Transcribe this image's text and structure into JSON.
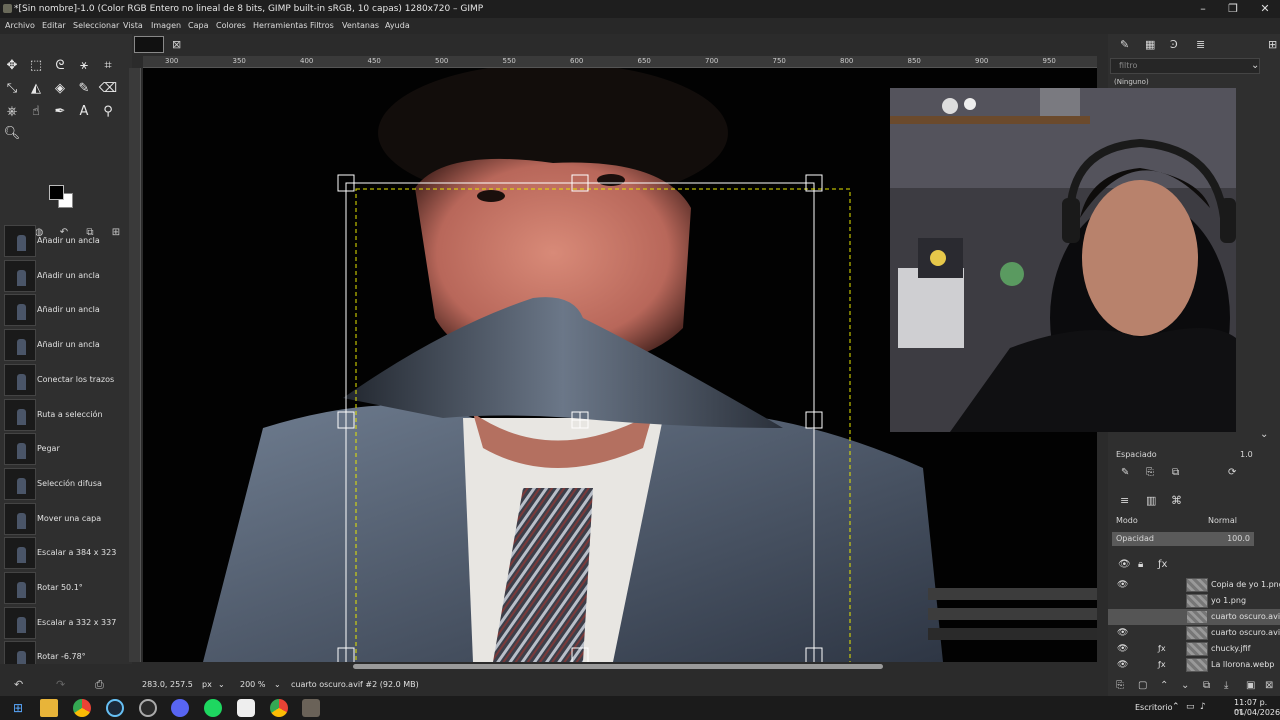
{
  "window": {
    "title": "*[Sin nombre]-1.0 (Color RGB Entero no lineal de 8 bits, GIMP built-in sRGB, 10 capas) 1280x720 – GIMP",
    "minimize": "–",
    "maximize": "❐",
    "close": "✕"
  },
  "menu": [
    "Archivo",
    "Editar",
    "Seleccionar",
    "Vista",
    "Imagen",
    "Capa",
    "Colores",
    "Herramientas",
    "Filtros",
    "Ventanas",
    "Ayuda"
  ],
  "history": [
    "Añadir un ancla",
    "Añadir un ancla",
    "Añadir un ancla",
    "Añadir un ancla",
    "Conectar los trazos",
    "Ruta a selección",
    "Pegar",
    "Selección difusa",
    "Mover una capa",
    "Escalar a 384 x 323",
    "Rotar 50.1°",
    "Escalar a 332 x 337",
    "Rotar -6.78°"
  ],
  "ruler": {
    "ticks": [
      "300",
      "350",
      "400",
      "450",
      "500",
      "550",
      "600",
      "650",
      "700",
      "750",
      "800",
      "850",
      "900",
      "950"
    ]
  },
  "status": {
    "coords": "283.0, 257.5",
    "unit": "px",
    "zoom": "200 %",
    "layer_info": "cuarto oscuro.avif #2 (92.0 MB)"
  },
  "dock": {
    "filter_placeholder": "filtro",
    "brush_none": "(Ninguno)",
    "spacing_label": "Espaciado",
    "spacing_value": "1.0",
    "mode_label": "Modo",
    "mode_value": "Normal",
    "opacity_label": "Opacidad",
    "opacity_value": "100.0"
  },
  "layers": [
    {
      "name": "Copia de yo 1.png",
      "visible": true,
      "fx": false
    },
    {
      "name": "yo 1.png",
      "visible": false,
      "fx": false
    },
    {
      "name": "cuarto oscuro.avif",
      "visible": false,
      "fx": false,
      "selected": true
    },
    {
      "name": "cuarto oscuro.avif",
      "visible": true,
      "fx": false
    },
    {
      "name": "chucky.jfif",
      "visible": true,
      "fx": true
    },
    {
      "name": "La llorona.webp",
      "visible": true,
      "fx": true
    }
  ],
  "taskbar": {
    "desktop_label": "Escritorio",
    "time": "11:07 p. m.",
    "date": "01/04/2026"
  },
  "colors": {
    "fg": "#000000",
    "bg": "#ffffff",
    "accent": "#5a5a5a"
  }
}
